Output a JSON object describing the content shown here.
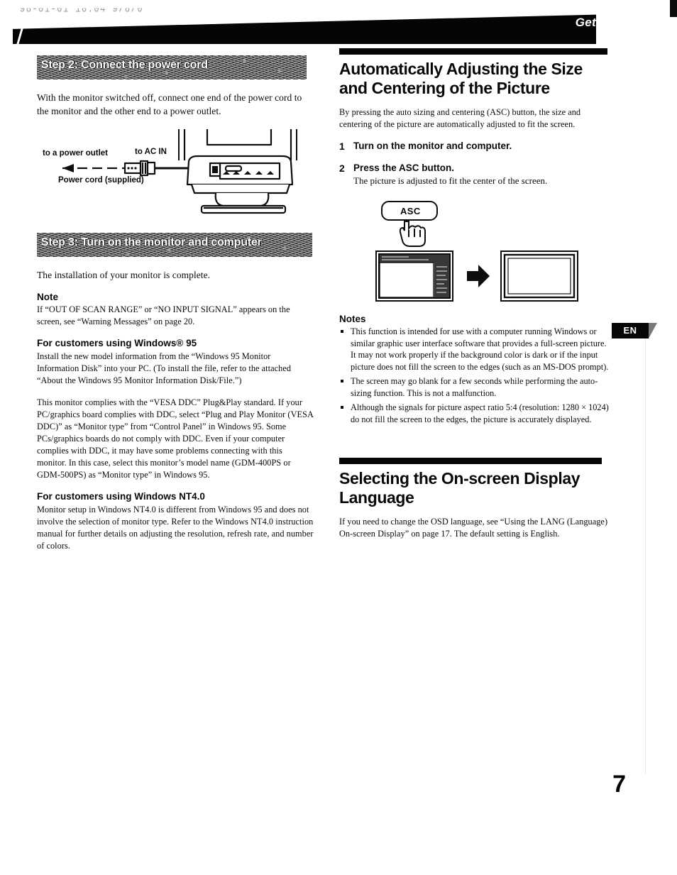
{
  "scan": {
    "date_stamp": "98-01-01 10:04  9/8/0",
    "page_number": "7"
  },
  "header": {
    "running_title": "Getting Started"
  },
  "side_tab": {
    "language_code": "EN"
  },
  "left_column": {
    "step2": {
      "heading": "Step 2: Connect the power cord",
      "body": "With the monitor switched off, connect one end of the power cord to the monitor and the other end to a power outlet.",
      "figure": {
        "label_outlet": "to a power outlet",
        "label_acin": "to AC IN",
        "label_cord": "Power cord (supplied)"
      }
    },
    "step3": {
      "heading": "Step 3: Turn on the monitor and computer",
      "body": "The installation of your monitor is complete.",
      "note_title": "Note",
      "note_body": "If “OUT OF SCAN RANGE” or “NO INPUT SIGNAL” appears on the screen, see “Warning Messages” on page 20.",
      "win95_title": "For customers using Windows® 95",
      "win95_p1": "Install the new model information from the “Windows 95 Monitor Information Disk” into your PC. (To install the file, refer to the attached “About the Windows 95 Monitor Information Disk/File.”)",
      "win95_p2": "This monitor complies with the “VESA DDC” Plug&Play standard. If your PC/graphics board complies with DDC, select “Plug and Play Monitor (VESA DDC)” as “Monitor type” from “Control Panel” in Windows 95. Some PCs/graphics boards do not comply with DDC. Even if your computer complies with DDC, it may have some problems connecting with this monitor. In this case, select this monitor’s model name (GDM-400PS or GDM-500PS) as “Monitor type” in Windows 95.",
      "nt40_title": "For customers using Windows NT4.0",
      "nt40_body": "Monitor setup in Windows NT4.0 is different from Windows 95 and does not involve the selection of monitor type. Refer to the Windows NT4.0 instruction manual for further details on adjusting the resolution, refresh rate, and number of colors."
    }
  },
  "right_column": {
    "asc_section": {
      "title": "Automatically Adjusting the Size and Centering of the Picture",
      "intro": "By pressing the auto sizing and centering (ASC) button, the size and centering of the picture are automatically adjusted to fit the screen.",
      "steps": [
        {
          "number": "1",
          "title": "Turn on the monitor and computer.",
          "detail": ""
        },
        {
          "number": "2",
          "title": "Press the ASC button.",
          "detail": "The picture is adjusted to fit the center of the screen."
        }
      ],
      "figure": {
        "button_label": "ASC"
      },
      "notes_title": "Notes",
      "notes": [
        "This function is intended for use with a computer running Windows or similar graphic user interface software that provides a full-screen picture.  It may not work properly if the background color is dark or if the input picture does not fill the screen to the edges (such as an MS-DOS prompt).",
        "The screen may go blank for a few seconds while performing the auto-sizing function. This is not a malfunction.",
        "Although the signals for picture aspect ratio 5:4 (resolution: 1280 × 1024) do not fill the screen to the edges, the picture is accurately displayed."
      ]
    },
    "osd_section": {
      "title": "Selecting the On-screen Display Language",
      "body": "If you need to change the OSD language, see “Using the LANG (Language) On-screen Display” on page 17. The default setting is English."
    }
  }
}
